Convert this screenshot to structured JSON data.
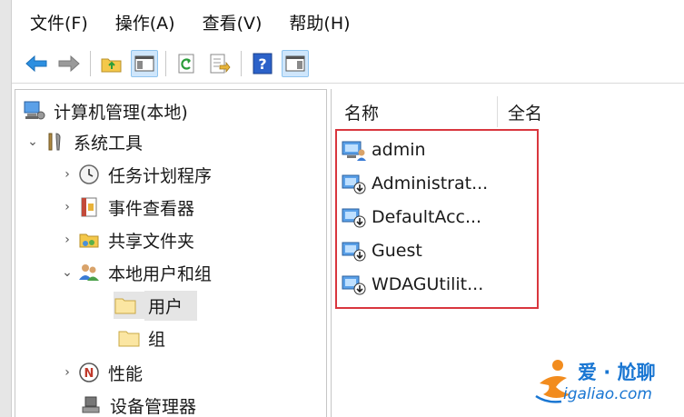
{
  "menu": {
    "file": "文件(F)",
    "action": "操作(A)",
    "view": "查看(V)",
    "help": "帮助(H)"
  },
  "toolbar": {
    "icons": [
      "back-arrow-icon",
      "forward-arrow-icon",
      "up-folder-icon",
      "show-hide-tree-icon",
      "refresh-icon",
      "export-list-icon",
      "help-icon",
      "action-pane-icon"
    ]
  },
  "tree": {
    "root": "计算机管理(本地)",
    "system_tools": "系统工具",
    "task_scheduler": "任务计划程序",
    "event_viewer": "事件查看器",
    "shared_folders": "共享文件夹",
    "local_users_groups": "本地用户和组",
    "users": "用户",
    "groups": "组",
    "performance": "性能",
    "device_manager": "设备管理器"
  },
  "list": {
    "columns": [
      "名称",
      "全名"
    ],
    "rows": [
      "admin",
      "Administrat...",
      "DefaultAcc...",
      "Guest",
      "WDAGUtilit..."
    ]
  },
  "watermark": {
    "title": "爱 · 尬聊",
    "url": "igaliao.com"
  },
  "colors": {
    "highlight": "#d9363e",
    "selection": "#e5e5e5",
    "accent": "#1976d2"
  }
}
